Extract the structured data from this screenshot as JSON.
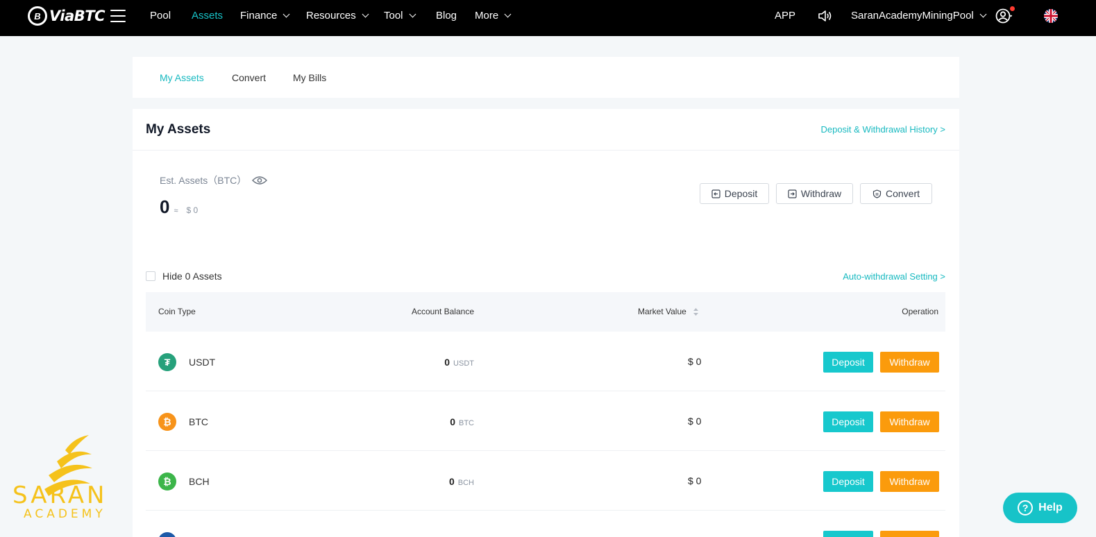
{
  "nav": {
    "logo_text": "ViaBTC",
    "items": [
      {
        "label": "Pool",
        "active": false,
        "dropdown": false
      },
      {
        "label": "Assets",
        "active": true,
        "dropdown": false
      },
      {
        "label": "Finance",
        "active": false,
        "dropdown": true
      },
      {
        "label": "Resources",
        "active": false,
        "dropdown": true
      },
      {
        "label": "Tool",
        "active": false,
        "dropdown": true
      },
      {
        "label": "Blog",
        "active": false,
        "dropdown": false
      },
      {
        "label": "More",
        "active": false,
        "dropdown": true
      }
    ],
    "app_label": "APP",
    "account_name": "SaranAcademyMiningPool"
  },
  "tabs": [
    {
      "label": "My Assets",
      "active": true
    },
    {
      "label": "Convert",
      "active": false
    },
    {
      "label": "My Bills",
      "active": false
    }
  ],
  "assets": {
    "title": "My Assets",
    "history_link": "Deposit & Withdrawal History >",
    "est_label": "Est. Assets（BTC）",
    "est_value": "0",
    "approx": "≈",
    "est_usd": "$ 0",
    "buttons": {
      "deposit": "Deposit",
      "withdraw": "Withdraw",
      "convert": "Convert"
    },
    "hide_label": "Hide 0 Assets",
    "auto_link": "Auto-withdrawal Setting >"
  },
  "table": {
    "headers": {
      "coin": "Coin Type",
      "balance": "Account Balance",
      "market": "Market Value",
      "operation": "Operation"
    },
    "rows": [
      {
        "coin": "USDT",
        "balance": "0",
        "unit": "USDT",
        "market": "$ 0",
        "color": "#26a17b",
        "glyph": "₮"
      },
      {
        "coin": "BTC",
        "balance": "0",
        "unit": "BTC",
        "market": "$ 0",
        "color": "#f7931a",
        "glyph": "₿"
      },
      {
        "coin": "BCH",
        "balance": "0",
        "unit": "BCH",
        "market": "$ 0",
        "color": "#3cb54a",
        "glyph": "₿"
      }
    ],
    "deposit_label": "Deposit",
    "withdraw_label": "Withdraw"
  },
  "watermark": {
    "line1": "SARAN",
    "line2": "ACADEMY"
  },
  "help_label": "Help",
  "colors": {
    "accent": "#17c3c8",
    "withdraw": "#fb9b0c",
    "nav_bg": "#000000"
  }
}
